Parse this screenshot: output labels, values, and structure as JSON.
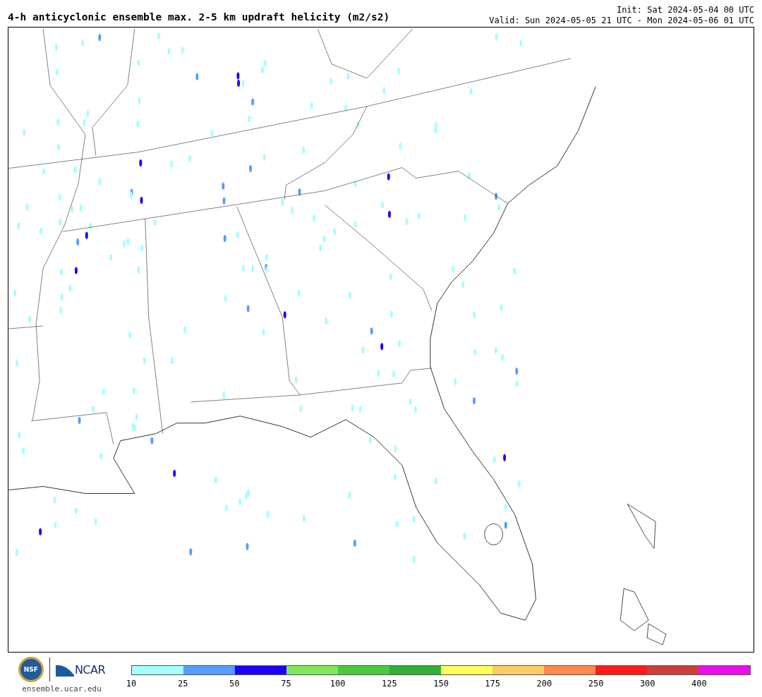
{
  "title": "4-h anticyclonic ensemble max. 2-5 km updraft helicity (m2/s2)",
  "init": "Init: Sat 2024-05-04 00 UTC",
  "valid": "Valid: Sun 2024-05-05 21 UTC - Mon 2024-05-06 01 UTC",
  "footer": {
    "nsf_mark": "NSF",
    "ncar_wordmark": "NCAR",
    "url": "ensemble.ucar.edu"
  },
  "colorbar": [
    {
      "label": "10",
      "color": "#a6ffff"
    },
    {
      "label": "25",
      "color": "#569dff"
    },
    {
      "label": "50",
      "color": "#1c00fa"
    },
    {
      "label": "75",
      "color": "#82e65a"
    },
    {
      "label": "100",
      "color": "#4dc93e"
    },
    {
      "label": "125",
      "color": "#2eaf37"
    },
    {
      "label": "150",
      "color": "#ffff5a"
    },
    {
      "label": "175",
      "color": "#ffcc69"
    },
    {
      "label": "200",
      "color": "#ff8a4f"
    },
    {
      "label": "250",
      "color": "#ff1a1a"
    },
    {
      "label": "300",
      "color": "#cc3d3d"
    },
    {
      "label": "400",
      "color": "#eb0deb"
    }
  ]
}
